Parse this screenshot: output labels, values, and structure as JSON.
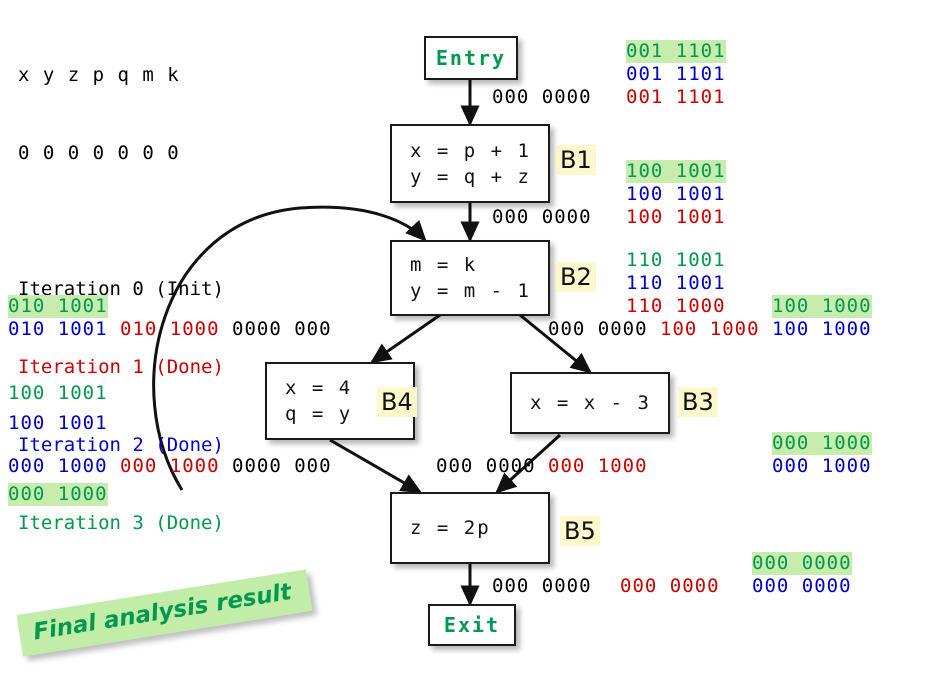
{
  "legend": {
    "variables": "x y z p q m k",
    "init_bits": "0 0 0 0 0 0 0",
    "iterations": [
      {
        "label": "Iteration 0 (Init)",
        "color": "#000000"
      },
      {
        "label": "Iteration 1 (Done)",
        "color": "#cc0000"
      },
      {
        "label": "Iteration 2 (Done)",
        "color": "#0000cc"
      },
      {
        "label": "Iteration 3 (Done)",
        "color": "#00994d"
      }
    ]
  },
  "nodes": {
    "entry": {
      "name": "Entry"
    },
    "exit": {
      "name": "Exit"
    },
    "b1": {
      "tag": "B1",
      "statements": [
        "x = p + 1",
        "y = q + z"
      ]
    },
    "b2": {
      "tag": "B2",
      "statements": [
        "m = k",
        "y = m - 1"
      ]
    },
    "b3": {
      "tag": "B3",
      "statements": [
        "x = x - 3"
      ]
    },
    "b4": {
      "tag": "B4",
      "statements": [
        "x = 4",
        "q = y"
      ]
    },
    "b5": {
      "tag": "B5",
      "statements": [
        "z = 2p"
      ]
    }
  },
  "labels": {
    "entry_out_green": "001 1101",
    "entry_out_blue": "001 1101",
    "entry_out_black": "000 0000",
    "entry_out_red": "001 1101",
    "b1_out_green": "100 1001",
    "b1_out_blue": "100 1001",
    "b1_out_black": "000 0000",
    "b1_out_red": "100 1001",
    "b2_out_green": "110 1001",
    "b2_out_blue": "110 1001",
    "b2_out_red": "110 1000",
    "b2_left_green": "010 1001",
    "b2_left_blue": "010 1001",
    "b2_left_red": "010 1000",
    "b2_left_black": "0000 000",
    "b2_right_black": "000 0000",
    "b2_right_red": "100 1000",
    "b3_in_green": "100 1000",
    "b3_in_blue": "100 1000",
    "b4_left_green_top": "100 1001",
    "b4_left_blue_top": "100 1001",
    "b4_left_blue_bot": "000 1000",
    "b4_left_red": "000 1000",
    "b4_left_black": "0000 000",
    "b4_left_green_bot": "000 1000",
    "b4_out_black": "000 0000",
    "b4_out_red": "000 1000",
    "b3_out_green": "000 1000",
    "b3_out_blue": "000 1000",
    "b5_out_black": "000 0000",
    "b5_out_red": "000 0000",
    "b5_out_blue": "000 0000",
    "b5_out_green": "000 0000"
  },
  "banner": {
    "text": "Final analysis result"
  },
  "colors": {
    "iter0": "#000000",
    "iter1": "#cc0000",
    "iter2": "#0000cc",
    "iter3": "#00994d",
    "highlight": "#c8ecae",
    "block_tag": "#fbf8cc"
  }
}
